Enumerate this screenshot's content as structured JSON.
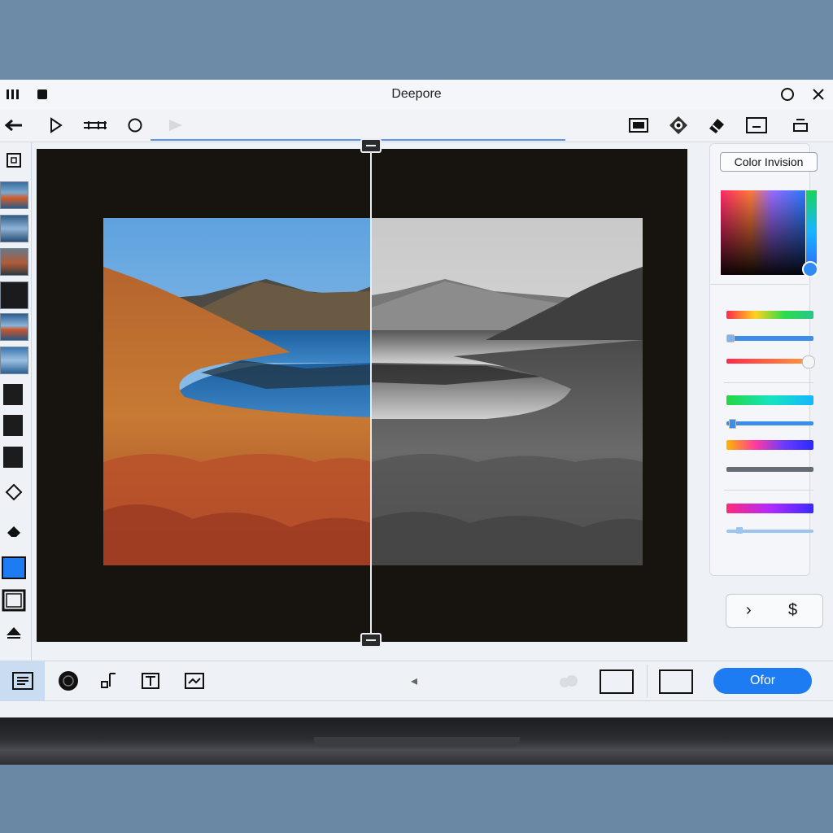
{
  "window": {
    "title": "Deepore",
    "left_icons": [
      "menu-bars-icon",
      "app-square-icon"
    ],
    "right_icons": [
      "circle-icon",
      "close-icon"
    ]
  },
  "toolbar": {
    "left_tools": [
      "back-arrow-icon",
      "play-outline-icon",
      "crop-tool-icon",
      "circle-tool-icon",
      "play-disabled-icon"
    ],
    "right_tools": [
      "frame-icon",
      "target-icon",
      "eraser-icon",
      "screen-icon",
      "tray-icon"
    ]
  },
  "left_rail": {
    "tools": [
      "select-tool-icon",
      "diamond-icon",
      "fill-icon",
      "blue-square-icon",
      "square-outline-icon",
      "triangle-icon"
    ],
    "thumbnails": 5,
    "swatches": 4
  },
  "canvas": {
    "split_view": "before-after",
    "left_mode": "color",
    "right_mode": "grayscale"
  },
  "right_panel": {
    "label": "Color Invision",
    "nav": {
      "prev": "›",
      "next": "$"
    }
  },
  "bottombar": {
    "tools": [
      "list-icon",
      "circle-filled-icon",
      "music-note-icon",
      "text-box-icon",
      "image-box-icon"
    ],
    "play_label": "◂",
    "offer_button": "Ofor"
  },
  "colors": {
    "accent": "#1d7cf2",
    "canvas_bg": "#17140f",
    "wallpaper": "#6a87a3"
  }
}
